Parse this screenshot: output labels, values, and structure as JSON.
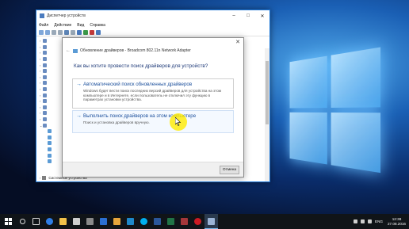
{
  "device_manager": {
    "title": "Диспетчер устройств",
    "menu": [
      "Файл",
      "Действие",
      "Вид",
      "Справка"
    ],
    "bottom_item": "Системные устройства"
  },
  "dialog": {
    "header": "Обновление драйверов - Broadcom 802.11n Network Adapter",
    "question": "Как вы хотите провести поиск драйверов для устройств?",
    "option1": {
      "title": "Автоматический поиск обновленных драйверов",
      "description": "Windows будет вести поиск последних версий драйверов для устройства на этом компьютере и в Интернете, если пользователь не отключил эту функцию в параметрах установки устройства."
    },
    "option2": {
      "title": "Выполнить поиск драйверов на этом компьютере",
      "description": "Поиск и установка драйверов вручную."
    },
    "cancel_label": "Отмена"
  },
  "taskbar": {
    "language": "ENG",
    "time": "12:38",
    "date": "27.08.2016"
  },
  "colors": {
    "accent": "#1f6fc0",
    "option_title": "#1b4f9c",
    "taskbar": "#101418",
    "cursor_highlight": "#ffeb00"
  },
  "icons": {
    "start": "windows-start-icon",
    "close": "close-icon",
    "back": "back-arrow-icon"
  }
}
